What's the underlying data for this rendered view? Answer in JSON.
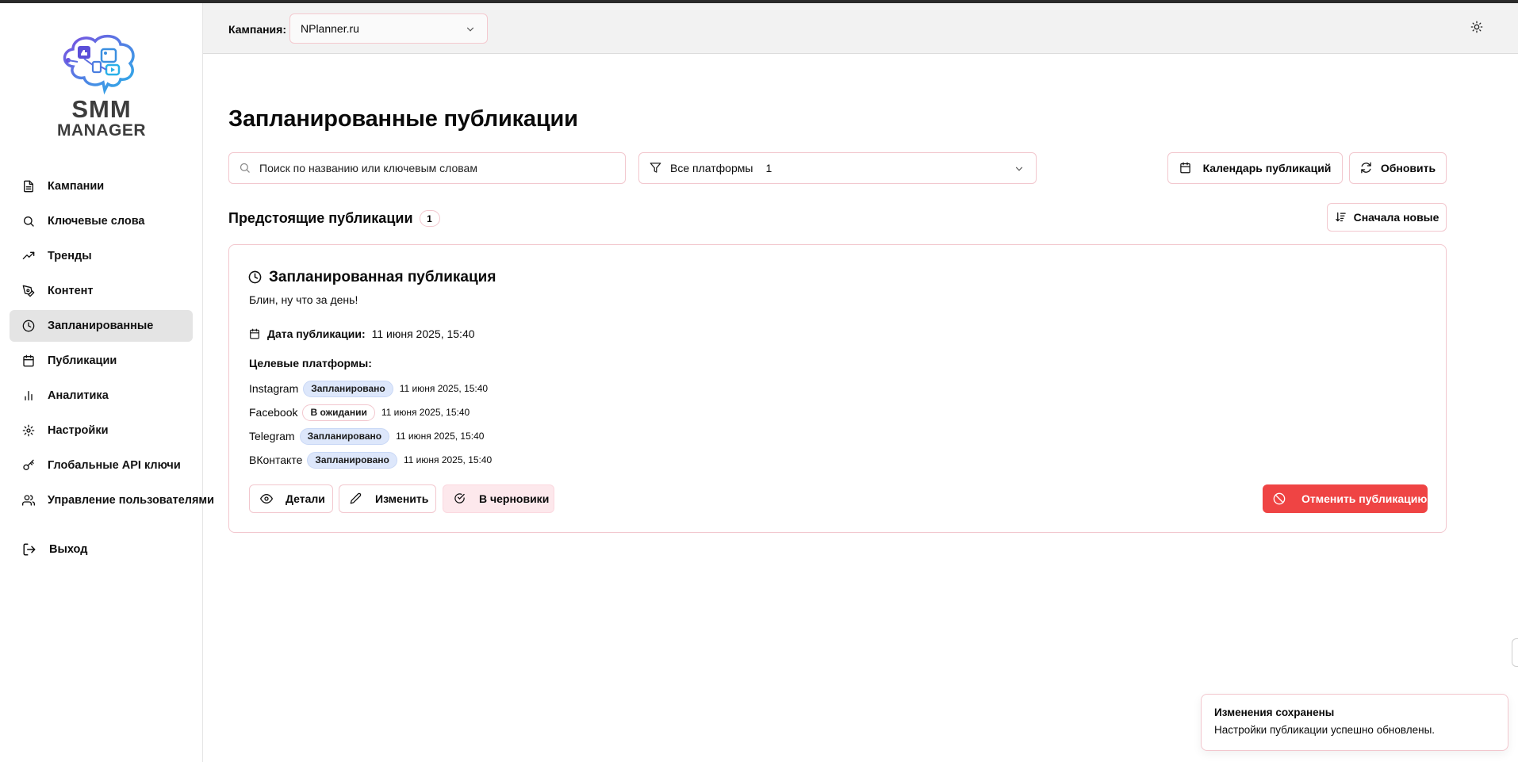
{
  "app": {
    "logo_line1": "SMM",
    "logo_line2": "MANAGER"
  },
  "sidebar": {
    "items": [
      {
        "label": "Кампании",
        "icon": "file-icon"
      },
      {
        "label": "Ключевые слова",
        "icon": "search-icon"
      },
      {
        "label": "Тренды",
        "icon": "trending-up-icon"
      },
      {
        "label": "Контент",
        "icon": "pen-tool-icon"
      },
      {
        "label": "Запланированные",
        "icon": "clock-icon",
        "active": true
      },
      {
        "label": "Публикации",
        "icon": "calendar-icon"
      },
      {
        "label": "Аналитика",
        "icon": "bar-chart-icon"
      },
      {
        "label": "Настройки",
        "icon": "gear-icon"
      },
      {
        "label": "Глобальные API ключи",
        "icon": "key-icon"
      },
      {
        "label": "Управление пользователями",
        "icon": "users-icon"
      }
    ],
    "logout": "Выход"
  },
  "header": {
    "campaign_label": "Кампания:",
    "campaign_value": "NPlanner.ru"
  },
  "main": {
    "title": "Запланированные публикации",
    "search_placeholder": "Поиск по названию или ключевым словам",
    "platform_filter": "Все платформы",
    "platform_filter_count": "1",
    "calendar_button": "Календарь публикаций",
    "refresh_button": "Обновить",
    "section_title": "Предстоящие публикации",
    "section_count": "1",
    "sort_button": "Сначала новые"
  },
  "post": {
    "title": "Запланированная публикация",
    "text": "Блин, ну что за день!",
    "date_label": "Дата публикации:",
    "date_value": "11 июня 2025, 15:40",
    "targets_label": "Целевые платформы:",
    "platforms": [
      {
        "name": "Instagram",
        "status": "Запланировано",
        "time": "11 июня 2025, 15:40"
      },
      {
        "name": "Facebook",
        "status": "В ожидании",
        "time": "11 июня 2025, 15:40"
      },
      {
        "name": "Telegram",
        "status": "Запланировано",
        "time": "11 июня 2025, 15:40"
      },
      {
        "name": "ВКонтакте",
        "status": "Запланировано",
        "time": "11 июня 2025, 15:40"
      }
    ],
    "details_button": "Детали",
    "edit_button": "Изменить",
    "drafts_button": "В черновики",
    "cancel_button": "Отменить публикацию"
  },
  "toast": {
    "title": "Изменения сохранены",
    "description": "Настройки публикации успешно обновлены."
  },
  "colors": {
    "accent_border": "#f2c7ce",
    "danger": "#ef4444",
    "status_scheduled_bg": "#dde7fb",
    "active_nav_bg": "#e4e4e4"
  }
}
